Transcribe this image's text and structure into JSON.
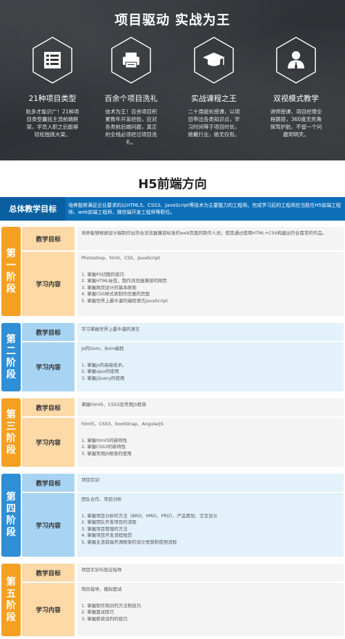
{
  "hero": {
    "title": "项目驱动 实战为王",
    "features": [
      {
        "icon": "list-icon",
        "title": "21种项目类型",
        "desc": "贴多才能识广！21种项目类型囊括主流前端框架，学员入职之后能够轻松独挑大梁。"
      },
      {
        "icon": "printer-icon",
        "title": "百余个项目洗礼",
        "desc": "技术为王！百余项目积累数年开发经验，应对各类前后端问题，真正的全栈必须经过项目洗礼。"
      },
      {
        "icon": "graduation-cap-icon",
        "title": "实战课程之王",
        "desc": "二十周超长授课，以项目带出各类知识点，学习时间等于项目时长，绝戴行业，绝无仅有。"
      },
      {
        "icon": "teacher-icon",
        "title": "双视模式教学",
        "desc": "讲师授课、项目经理全程跟班，360度无死角保驾护航，不留一个问题到明天。"
      }
    ]
  },
  "section_title": "H5前端方向",
  "overall": {
    "label": "总体教学目标",
    "text": "培养能够满足企业要求的以HTML5、CSS3、JavaScript等技术为主要能力的工程师。完成学习后的工程师应当胜任H5前端工程师、web前端工程师、微信端开发工程师等职位。"
  },
  "stages": [
    {
      "label": "第一阶段",
      "goal_label": "教学目标",
      "goal": "培养能够根据设计稿制作出符合浏览器兼容标准的web页面的制作人员；使其通过使用HTML+CSS构建出符合需求的作品。",
      "content_label": "学习内容",
      "content_head": "Photoshop、html、CSS、JavaScript",
      "items": [
        "1. 掌握PS切图的技巧",
        "2. 掌握HTML标签，制作浏览器兼容的网页",
        "3. 掌握网页设计的基本原则",
        "4. 掌握CSS样式表制作优雅的页面",
        "5. 掌握世界上最牛逼的编程语言JavaScript"
      ]
    },
    {
      "label": "第二阶段",
      "goal_label": "教学目标",
      "goal": "学习掌握世界上最牛逼的语言",
      "content_label": "学习内容",
      "content_head": "Js的Dom、Bom编程",
      "items": [
        "1. 掌握js的高级技术。",
        "2. 掌握ajax的使用",
        "3. 掌握jQuery的使用"
      ]
    },
    {
      "label": "第三阶段",
      "goal_label": "教学目标",
      "goal": "掌握html5、CSS3及常用JS框架",
      "content_label": "学习内容",
      "content_head": "html5，CSS3、bootStrap、AngularJS",
      "items": [
        "1. 掌握html5的新特性",
        "2. 掌握CSS3的新特性",
        "3. 掌握常用JS框架的使用"
      ]
    },
    {
      "label": "第四阶段",
      "goal_label": "教学目标",
      "goal": "项目实训",
      "content_label": "学习内容",
      "content_head": "团队合作、项目分析",
      "items": [
        "1. 掌握项目分析的方法（BRD、MRD、PRD）、产品策划、交互设计",
        "2. 掌握团队开发项目的流程",
        "3. 掌握项目管理的方法",
        "4. 掌握项目开发流程规范",
        "5. 掌握主流前端开源框架的设计思想和使用流程"
      ]
    },
    {
      "label": "第五阶段",
      "goal_label": "教学目标",
      "goal": "项目实训与就业指导",
      "content_label": "学习内容",
      "content_head": "简历指导、模拟面试",
      "items": [
        "1. 掌握制作简历的方法和技巧",
        "2. 掌握面试技巧",
        "3. 掌握薪资谈判的技巧"
      ]
    }
  ]
}
